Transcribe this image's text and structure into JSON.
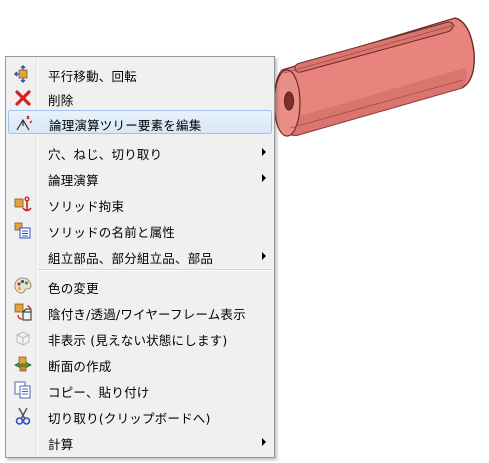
{
  "menu": {
    "items": [
      {
        "label": "平行移動、回転",
        "icon": "move-rotate-icon"
      },
      {
        "label": "削除",
        "icon": "delete-icon"
      },
      {
        "label": "論理演算ツリー要素を編集",
        "icon": "tree-edit-icon",
        "highlighted": true
      },
      {
        "label": "穴、ねじ、切り取り",
        "submenu": true
      },
      {
        "label": "論理演算",
        "submenu": true
      },
      {
        "label": "ソリッド拘束",
        "icon": "anchor-icon"
      },
      {
        "label": "ソリッドの名前と属性",
        "icon": "properties-icon"
      },
      {
        "label": "組立部品、部分組立品、部品",
        "submenu": true
      },
      {
        "label": "色の変更",
        "icon": "palette-icon"
      },
      {
        "label": "陰付き/透過/ワイヤーフレーム表示",
        "icon": "display-mode-icon"
      },
      {
        "label": "非表示 (見えない状態にします)",
        "icon": "hide-icon"
      },
      {
        "label": "断面の作成",
        "icon": "section-icon"
      },
      {
        "label": "コピー、貼り付け",
        "icon": "copy-paste-icon"
      },
      {
        "label": "切り取り(クリップボードへ)",
        "icon": "scissors-icon"
      },
      {
        "label": "計算",
        "submenu": true
      }
    ]
  },
  "colors": {
    "model_fill": "#e8837d",
    "model_edge": "#6e2b28",
    "highlight": "#d6e8f8"
  }
}
